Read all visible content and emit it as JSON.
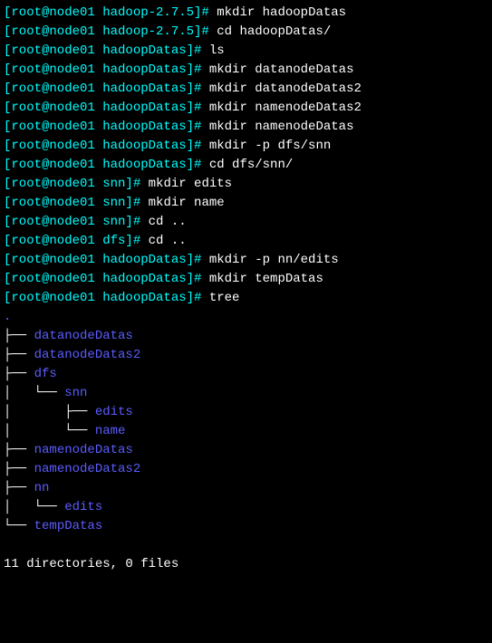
{
  "lines": [
    {
      "type": "cmd",
      "user": "root",
      "host": "node01",
      "dir": "hadoop-2.7.5",
      "command": "mkdir hadoopDatas"
    },
    {
      "type": "cmd",
      "user": "root",
      "host": "node01",
      "dir": "hadoop-2.7.5",
      "command": "cd hadoopDatas/"
    },
    {
      "type": "cmd",
      "user": "root",
      "host": "node01",
      "dir": "hadoopDatas",
      "command": "ls"
    },
    {
      "type": "cmd",
      "user": "root",
      "host": "node01",
      "dir": "hadoopDatas",
      "command": "mkdir datanodeDatas"
    },
    {
      "type": "cmd",
      "user": "root",
      "host": "node01",
      "dir": "hadoopDatas",
      "command": "mkdir datanodeDatas2"
    },
    {
      "type": "cmd",
      "user": "root",
      "host": "node01",
      "dir": "hadoopDatas",
      "command": "mkdir namenodeDatas2"
    },
    {
      "type": "cmd",
      "user": "root",
      "host": "node01",
      "dir": "hadoopDatas",
      "command": "mkdir namenodeDatas"
    },
    {
      "type": "cmd",
      "user": "root",
      "host": "node01",
      "dir": "hadoopDatas",
      "command": "mkdir -p dfs/snn"
    },
    {
      "type": "cmd",
      "user": "root",
      "host": "node01",
      "dir": "hadoopDatas",
      "command": "cd dfs/snn/"
    },
    {
      "type": "cmd",
      "user": "root",
      "host": "node01",
      "dir": "snn",
      "command": "mkdir edits"
    },
    {
      "type": "cmd",
      "user": "root",
      "host": "node01",
      "dir": "snn",
      "command": "mkdir name"
    },
    {
      "type": "cmd",
      "user": "root",
      "host": "node01",
      "dir": "snn",
      "command": "cd .."
    },
    {
      "type": "cmd",
      "user": "root",
      "host": "node01",
      "dir": "dfs",
      "command": "cd .."
    },
    {
      "type": "cmd",
      "user": "root",
      "host": "node01",
      "dir": "hadoopDatas",
      "command": "mkdir -p nn/edits"
    },
    {
      "type": "cmd",
      "user": "root",
      "host": "node01",
      "dir": "hadoopDatas",
      "command": "mkdir tempDatas"
    },
    {
      "type": "cmd",
      "user": "root",
      "host": "node01",
      "dir": "hadoopDatas",
      "command": "tree"
    }
  ],
  "tree": {
    "root": ".",
    "entries": [
      {
        "prefix": "├── ",
        "name": "datanodeDatas"
      },
      {
        "prefix": "├── ",
        "name": "datanodeDatas2"
      },
      {
        "prefix": "├── ",
        "name": "dfs"
      },
      {
        "prefix": "│   └── ",
        "name": "snn"
      },
      {
        "prefix": "│       ├── ",
        "name": "edits"
      },
      {
        "prefix": "│       └── ",
        "name": "name"
      },
      {
        "prefix": "├── ",
        "name": "namenodeDatas"
      },
      {
        "prefix": "├── ",
        "name": "namenodeDatas2"
      },
      {
        "prefix": "├── ",
        "name": "nn"
      },
      {
        "prefix": "│   └── ",
        "name": "edits"
      },
      {
        "prefix": "└── ",
        "name": "tempDatas"
      }
    ]
  },
  "summary": "11 directories, 0 files"
}
